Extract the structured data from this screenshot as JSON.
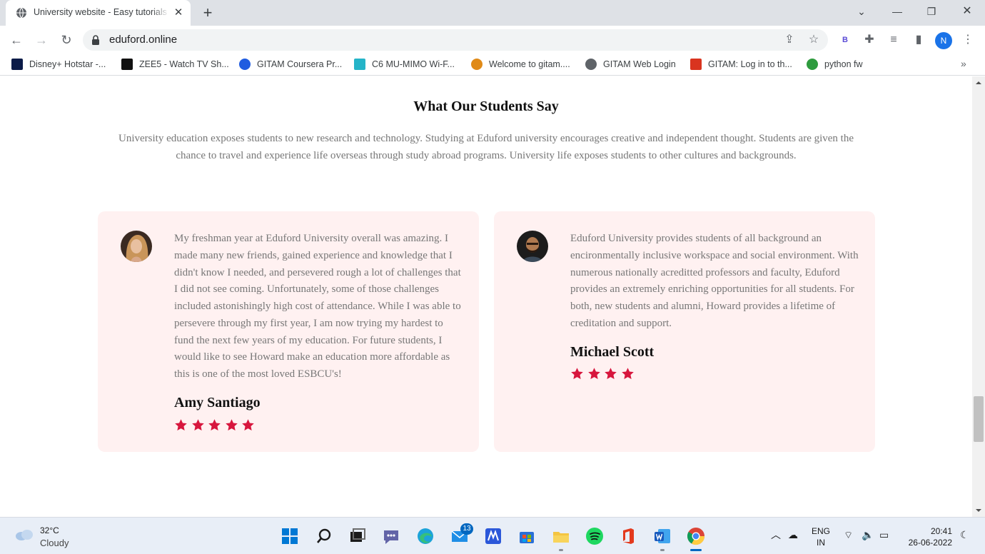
{
  "browser": {
    "tab_title": "University website - Easy tutorials",
    "tab_close": "✕",
    "new_tab": "+",
    "url": "eduford.online",
    "profile_initial": "N",
    "extension_label": "B",
    "bookmarks": [
      {
        "label": "Disney+ Hotstar -...",
        "icon": "hotstar-icon",
        "color": "#0b1b48"
      },
      {
        "label": "ZEE5 - Watch TV Sh...",
        "icon": "zee5-icon",
        "color": "#111111"
      },
      {
        "label": "GITAM Coursera Pr...",
        "icon": "coursera-icon",
        "color": "#1f5ce0"
      },
      {
        "label": "C6 MU-MIMO Wi-F...",
        "icon": "wifi-router-icon",
        "color": "#25b4c8"
      },
      {
        "label": "Welcome to gitam....",
        "icon": "gitam-sun-icon",
        "color": "#e08a17"
      },
      {
        "label": "GITAM Web Login",
        "icon": "globe-icon",
        "color": "#5f6368"
      },
      {
        "label": "GITAM: Log in to th...",
        "icon": "gitam-logo-icon",
        "color": "#d9341f"
      },
      {
        "label": "python fw",
        "icon": "python-fw-icon",
        "color": "#2e9b3e"
      }
    ],
    "bookmarks_more": "»"
  },
  "page": {
    "section_title": "What Our Students Say",
    "section_description": "University education exposes students to new research and technology. Studying at Eduford university encourages creative and independent thought. Students are given the chance to travel and experience life overseas through study abroad programs. University life exposes students to other cultures and backgrounds.",
    "testimonials": [
      {
        "quote": "My freshman year at Eduford University overall was amazing. I made many new friends, gained experience and knowledge that I didn't know I needed, and persevered rough a lot of challenges that I did not see coming. Unfortunately, some of those challenges included astonishingly high cost of attendance. While I was able to persevere through my first year, I am now trying my hardest to fund the next few years of my education. For future students, I would like to see Howard make an education more affordable as this is one of the most loved ESBCU's!",
        "author": "Amy Santiago",
        "rating": 5
      },
      {
        "quote": "Eduford University provides students of all background an encironmentally inclusive workspace and social environment. With numerous nationally acreditted professors and faculty, Eduford provides an extremely enriching opportunities for all students. For both, new students and alumni, Howard provides a lifetime of creditation and support.",
        "author": "Michael Scott",
        "rating": 4
      }
    ],
    "star_color": "#d7163d",
    "card_bg": "#fff1f1"
  },
  "taskbar": {
    "temperature": "32°C",
    "weather": "Cloudy",
    "mail_badge": "13",
    "lang_line1": "ENG",
    "lang_line2": "IN",
    "time": "20:41",
    "date": "26-06-2022"
  }
}
